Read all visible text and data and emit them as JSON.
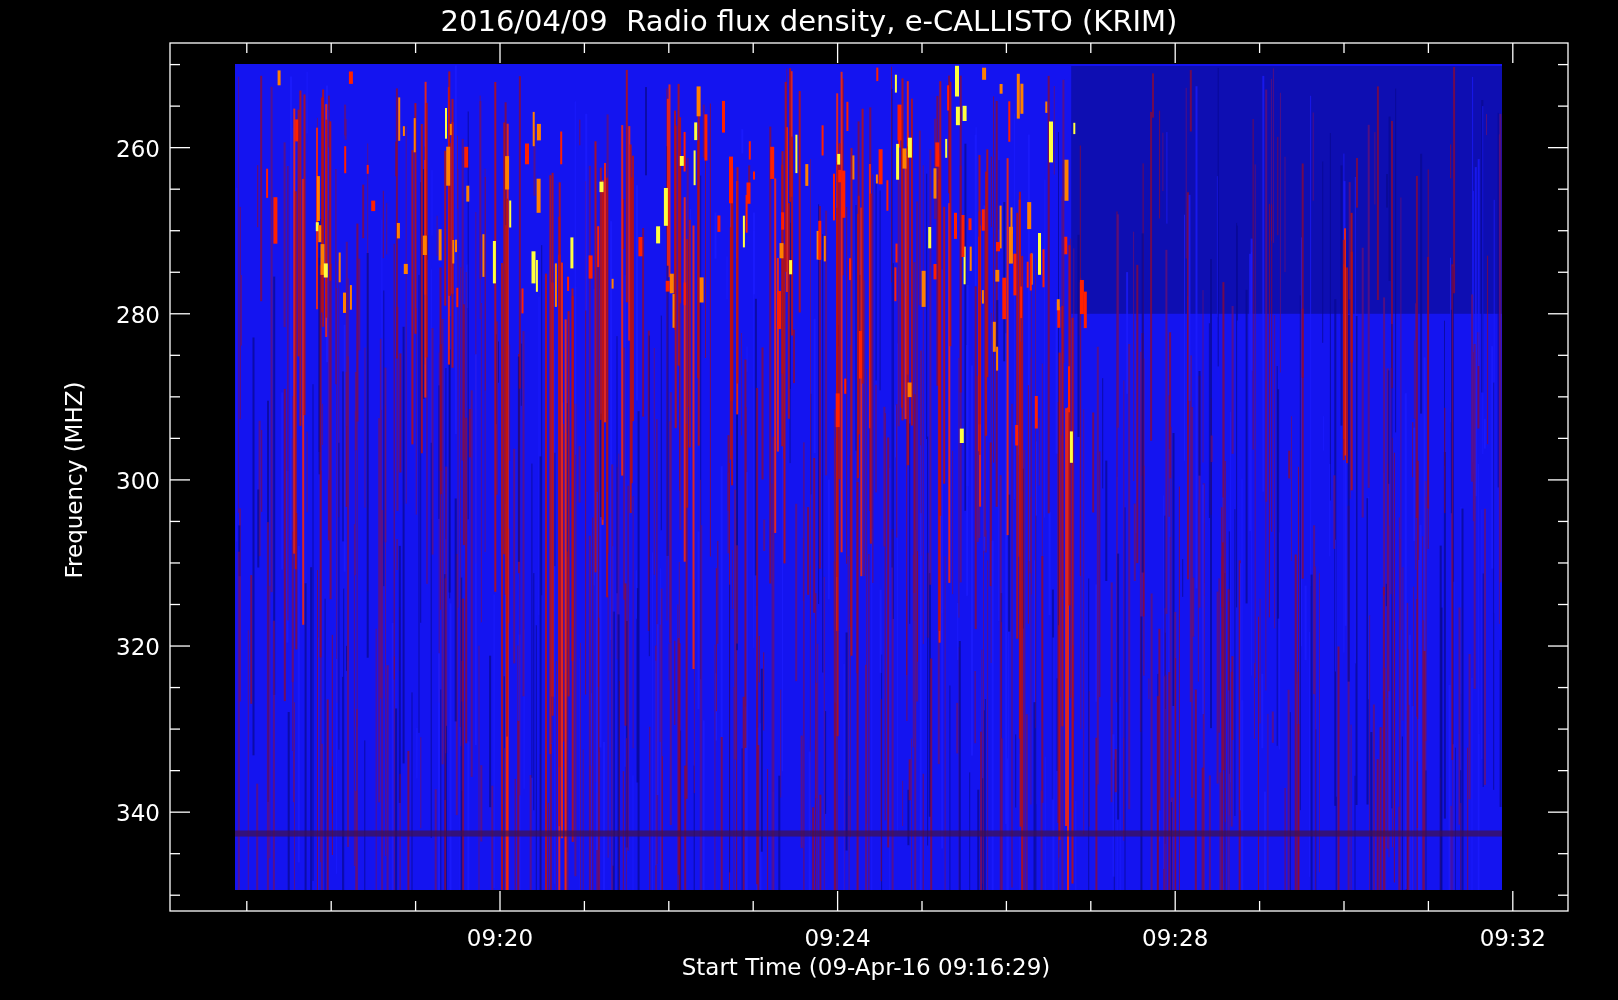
{
  "title": "2016/04/09  Radio flux density, e-CALLISTO (KRIM)",
  "plot": {
    "ylabel": "Frequency (MHZ)",
    "xlabel": "Start Time (09-Apr-16 09:16:29)",
    "yticks": [
      "260",
      "280",
      "300",
      "320",
      "340"
    ],
    "xticks": [
      "09:20",
      "09:24",
      "09:28",
      "09:32"
    ]
  }
}
